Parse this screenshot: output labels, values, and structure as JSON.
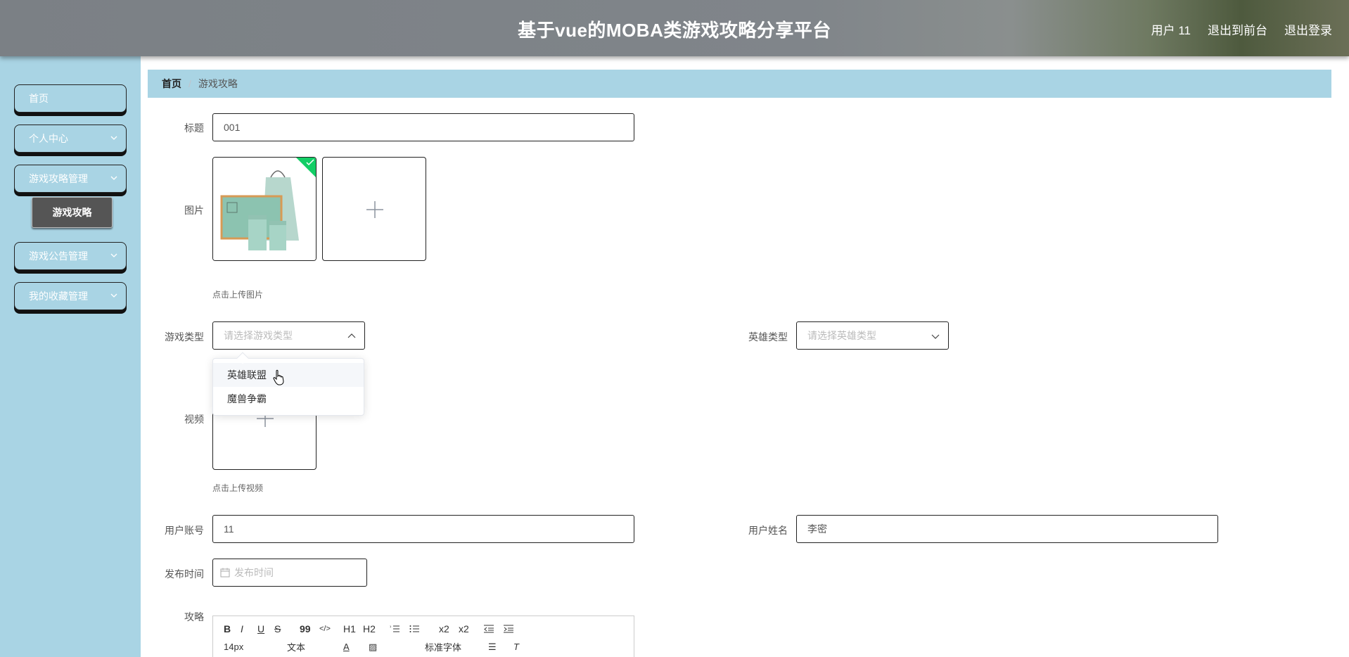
{
  "header": {
    "title": "基于vue的MOBA类游戏攻略分享平台",
    "user": "用户 11",
    "to_front": "退出到前台",
    "logout": "退出登录"
  },
  "sidebar": {
    "items": [
      {
        "label": "首页",
        "expandable": false
      },
      {
        "label": "个人中心",
        "expandable": true
      },
      {
        "label": "游戏攻略管理",
        "expandable": true
      },
      {
        "label": "游戏公告管理",
        "expandable": true
      },
      {
        "label": "我的收藏管理",
        "expandable": true
      }
    ],
    "active_sub": "游戏攻略"
  },
  "breadcrumb": {
    "home": "首页",
    "separator": "/",
    "current": "游戏攻略"
  },
  "form": {
    "title_label": "标题",
    "title_value": "001",
    "image_label": "图片",
    "image_hint": "点击上传图片",
    "game_type_label": "游戏类型",
    "game_type_placeholder": "请选择游戏类型",
    "hero_type_label": "英雄类型",
    "hero_type_placeholder": "请选择英雄类型",
    "video_label": "视频",
    "video_hint": "点击上传视频",
    "account_label": "用户账号",
    "account_value": "11",
    "name_label": "用户姓名",
    "name_value": "李密",
    "publish_label": "发布时间",
    "publish_placeholder": "发布时间",
    "strategy_label": "攻略"
  },
  "dropdown": {
    "options": [
      "英雄联盟",
      "魔兽争霸"
    ],
    "hovered": 0
  },
  "editor": {
    "row1": [
      "B",
      "I",
      "U",
      "S",
      "99",
      "</>",
      "H1",
      "H2",
      "ol",
      "ul",
      "x2",
      "x2",
      "outdent",
      "indent"
    ],
    "font_size": "14px",
    "block": "文本",
    "font": "标准字体"
  },
  "colors": {
    "accent": "#a9d4e4",
    "success": "#13ce66"
  }
}
